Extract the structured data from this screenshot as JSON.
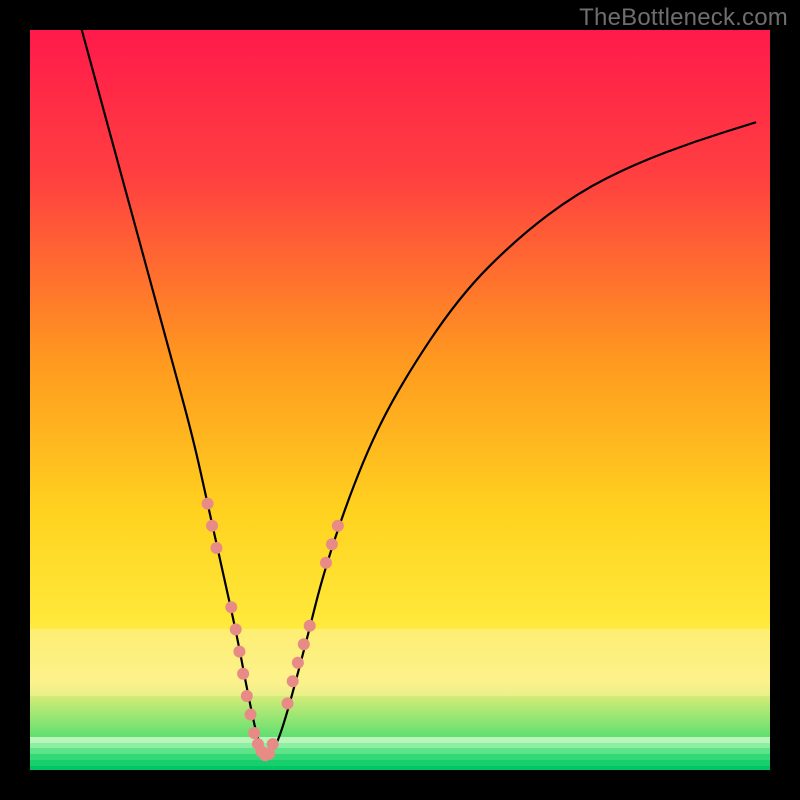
{
  "watermark": {
    "text": "TheBottleneck.com"
  },
  "chart_data": {
    "type": "line",
    "title": "",
    "xlabel": "",
    "ylabel": "",
    "xlim": [
      0,
      100
    ],
    "ylim": [
      0,
      100
    ],
    "grid": false,
    "legend": false,
    "background": {
      "gradient_stops": [
        {
          "pct": 0,
          "color": "#ff1a4b"
        },
        {
          "pct": 20,
          "color": "#ff4040"
        },
        {
          "pct": 45,
          "color": "#ff9a1f"
        },
        {
          "pct": 65,
          "color": "#ffd21f"
        },
        {
          "pct": 80,
          "color": "#ffe93a"
        },
        {
          "pct": 88,
          "color": "#fff07a"
        },
        {
          "pct": 100,
          "color": "#00d66b"
        }
      ],
      "highlight_band": {
        "y_from": 81,
        "y_to": 90,
        "color": "#fcf29a"
      },
      "green_strips": [
        {
          "y": 95.5,
          "color": "#b9f5b9"
        },
        {
          "y": 96.3,
          "color": "#8ceea0"
        },
        {
          "y": 97.0,
          "color": "#5ee38a"
        },
        {
          "y": 97.8,
          "color": "#33d977"
        },
        {
          "y": 98.6,
          "color": "#18cf6d"
        },
        {
          "y": 99.4,
          "color": "#00c763"
        }
      ]
    },
    "series": [
      {
        "name": "bottleneck-curve",
        "color": "#000000",
        "x": [
          7,
          10,
          13,
          16,
          19,
          22,
          24,
          26,
          28,
          29.5,
          31,
          32.5,
          34,
          37,
          40,
          45,
          50,
          58,
          66,
          74,
          82,
          90,
          98
        ],
        "y": [
          100,
          89,
          78,
          67,
          56,
          45,
          36,
          27,
          18,
          10,
          3,
          2,
          5,
          16,
          28,
          42,
          52,
          64,
          72,
          78,
          82,
          85,
          87.5
        ]
      }
    ],
    "scatter": {
      "name": "sample-points",
      "color": "#e88b87",
      "radius": 6,
      "points": [
        {
          "x": 24.0,
          "y": 36
        },
        {
          "x": 24.6,
          "y": 33
        },
        {
          "x": 25.2,
          "y": 30
        },
        {
          "x": 27.2,
          "y": 22
        },
        {
          "x": 27.8,
          "y": 19
        },
        {
          "x": 28.3,
          "y": 16
        },
        {
          "x": 28.8,
          "y": 13
        },
        {
          "x": 29.3,
          "y": 10
        },
        {
          "x": 29.8,
          "y": 7.5
        },
        {
          "x": 30.3,
          "y": 5
        },
        {
          "x": 30.8,
          "y": 3.5
        },
        {
          "x": 31.3,
          "y": 2.5
        },
        {
          "x": 31.8,
          "y": 2
        },
        {
          "x": 32.3,
          "y": 2.2
        },
        {
          "x": 32.8,
          "y": 3.5
        },
        {
          "x": 34.8,
          "y": 9
        },
        {
          "x": 35.5,
          "y": 12
        },
        {
          "x": 36.2,
          "y": 14.5
        },
        {
          "x": 37.0,
          "y": 17
        },
        {
          "x": 37.8,
          "y": 19.5
        },
        {
          "x": 40.0,
          "y": 28
        },
        {
          "x": 40.8,
          "y": 30.5
        },
        {
          "x": 41.6,
          "y": 33
        }
      ]
    }
  },
  "colors": {
    "frame": "#000000",
    "curve": "#000000",
    "scatter": "#e88b87",
    "watermark": "#6e6e6e"
  }
}
